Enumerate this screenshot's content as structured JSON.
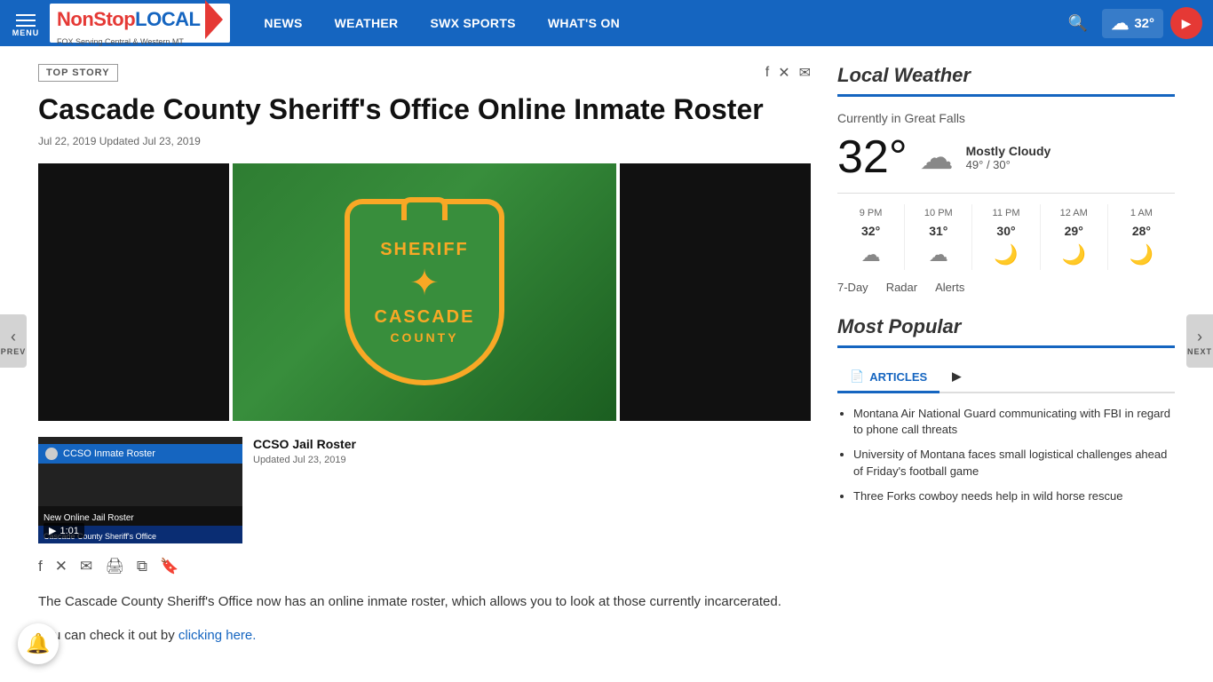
{
  "nav": {
    "menu_label": "MENU",
    "logo_text": "NonStop LOCAL",
    "logo_sub": "FOX Serving Central & Western MT",
    "links": [
      "NEWS",
      "WEATHER",
      "SWX SPORTS",
      "WHAT'S ON"
    ],
    "temp": "32°",
    "live_label": "▶"
  },
  "article": {
    "badge": "TOP STORY",
    "title": "Cascade County Sheriff's Office Online Inmate Roster",
    "date": "Jul 22, 2019",
    "updated": "Updated Jul 23, 2019",
    "share_top": [
      "facebook-icon",
      "twitter-x-icon",
      "email-icon"
    ],
    "body_p1": "The Cascade County Sheriff's Office now has an online inmate roster, which allows you to look at those currently incarcerated.",
    "body_p2": "You can check it out by ",
    "link_text": "clicking here.",
    "link_href": "#"
  },
  "video": {
    "duration": "1:01",
    "title": "CCSO Jail Roster",
    "date": "Updated Jul 23, 2019",
    "overlay_line1": "New Online Jail Roster",
    "overlay_line2": "Cascade County Sheriff's Office"
  },
  "badge_text": {
    "line1": "SHERIFF",
    "line2": "CASCADE",
    "line3": "COUNTY"
  },
  "sidebar": {
    "weather_title": "Local Weather",
    "weather_location": "Currently in Great Falls",
    "weather_temp": "32°",
    "weather_desc": "Mostly Cloudy",
    "weather_hi": "49°",
    "weather_lo": "30°",
    "hourly": [
      {
        "label": "9 PM",
        "temp": "32°",
        "icon": "☁"
      },
      {
        "label": "10 PM",
        "temp": "31°",
        "icon": "☁"
      },
      {
        "label": "11 PM",
        "temp": "30°",
        "icon": "🌙"
      },
      {
        "label": "12 AM",
        "temp": "29°",
        "icon": "🌙"
      },
      {
        "label": "1 AM",
        "temp": "28°",
        "icon": "🌙"
      }
    ],
    "weather_links": [
      "7-Day",
      "Radar",
      "Alerts"
    ],
    "popular_title": "Most Popular",
    "popular_tabs": [
      {
        "label": "ARTICLES",
        "icon": "📄",
        "active": true
      },
      {
        "label": "",
        "icon": "▶",
        "active": false
      }
    ],
    "popular_items": [
      "Montana Air National Guard communicating with FBI in regard to phone call threats",
      "University of Montana faces small logistical challenges ahead of Friday's football game",
      "Three Forks cowboy needs help in wild horse rescue"
    ]
  },
  "nav_arrows": {
    "prev": "PREV",
    "next": "NEXT"
  }
}
